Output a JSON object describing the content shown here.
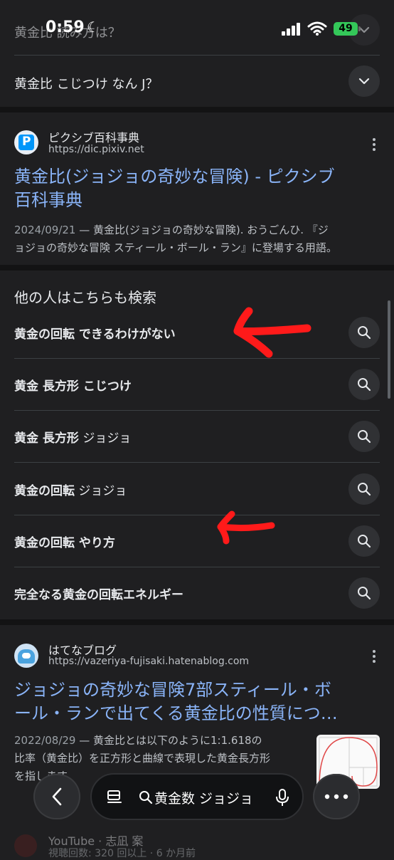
{
  "status_bar": {
    "time": "0:59",
    "battery": "49"
  },
  "faq": {
    "partial_item": "黄金比 読み方は？",
    "item": "黄金比 こじつけ なん J？"
  },
  "result1": {
    "site_name": "ピクシブ百科事典",
    "url": "https://dic.pixiv.net",
    "title_line1": "黄金比(ジョジョの奇妙な冒険) - ピクシブ",
    "title_line2": "百科事典",
    "date": "2024/09/21",
    "snippet_line1": " — 黄金比(ジョジョの奇妙な冒険). おうごんひ. 『ジ",
    "snippet_line2": "ョジョの奇妙な冒険 スティール・ボール・ラン』に登場する用語。"
  },
  "related": {
    "heading": "他の人はこちらも検索",
    "items": [
      {
        "bold": "黄金の回転 できるわけがない",
        "light": ""
      },
      {
        "bold": "黄金 長方形 こじつけ",
        "light": ""
      },
      {
        "bold": "黄金 長方形",
        "light": " ジョジョ"
      },
      {
        "bold": "黄金の回転",
        "light": " ジョジョ"
      },
      {
        "bold": "黄金の回転 やり方",
        "light": ""
      },
      {
        "bold": "完全なる黄金の回転エネルギー",
        "light": ""
      }
    ]
  },
  "result2": {
    "site_name": "はてなブログ",
    "url": "https://vazeriya-fujisaki.hatenablog.com",
    "title_line1": "ジョジョの奇妙な冒険7部スティール・ボ",
    "title_line2": "ール・ランで出てくる黄金比の性質につ…",
    "date": "2022/08/29",
    "snippet_line1": " — 黄金比とは以下のように1:1.618の",
    "snippet_line2": "比率（黄金比）を正方形と曲線で表現した黄金長方形",
    "snippet_line3": "を指します。"
  },
  "result3": {
    "site_name": "YouTube · 志凪 案",
    "meta": "視聴回数: 320 回以上 · 6 か月前"
  },
  "bottom_bar": {
    "query": "黄金数 ジョジョ"
  },
  "colors": {
    "link": "#8ab4f8",
    "background": "#1f1f21",
    "annotation": "#ff1a1a"
  }
}
